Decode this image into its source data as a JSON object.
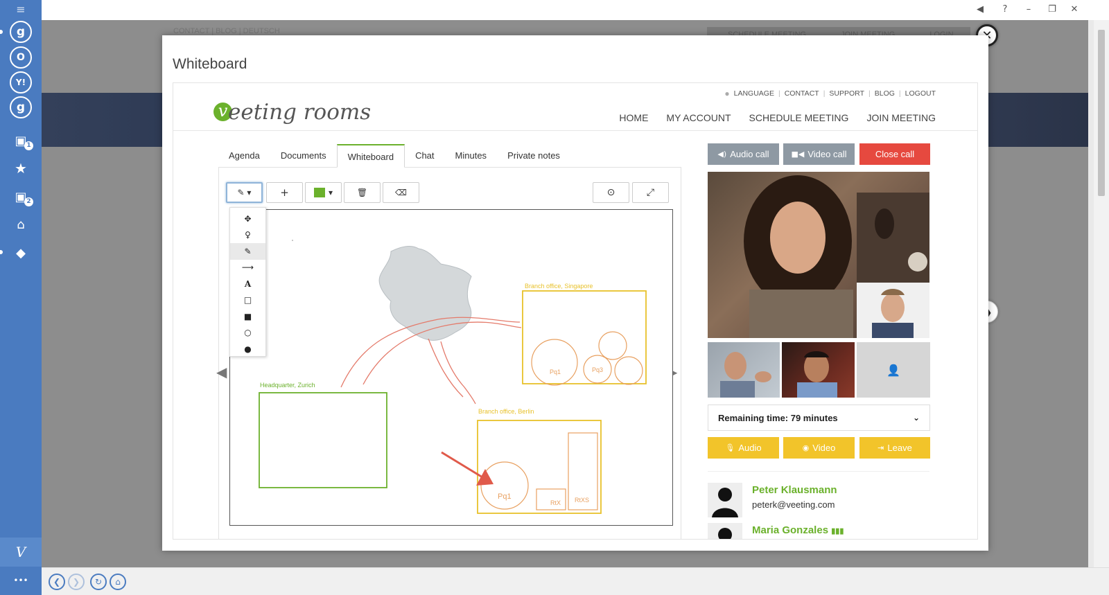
{
  "window": {
    "controls": [
      "◀",
      "?",
      "–",
      "❐",
      "✕"
    ]
  },
  "sidebar": {
    "items": [
      {
        "name": "menu",
        "glyph": "≡",
        "badge": ""
      },
      {
        "name": "google-account-1",
        "glyph": "g",
        "badge": ""
      },
      {
        "name": "outlook",
        "glyph": "O",
        "badge": ""
      },
      {
        "name": "yahoo",
        "glyph": "Y!",
        "badge": ""
      },
      {
        "name": "google-account-2",
        "glyph": "g",
        "badge": ""
      },
      {
        "name": "meetings-1",
        "glyph": "▣",
        "badge": "1"
      },
      {
        "name": "favorites",
        "glyph": "★",
        "badge": ""
      },
      {
        "name": "meetings-2",
        "glyph": "▣",
        "badge": "2"
      },
      {
        "name": "inbox",
        "glyph": "⌂",
        "badge": ""
      },
      {
        "name": "tags",
        "glyph": "◆",
        "badge": ""
      },
      {
        "name": "veeting",
        "glyph": "V",
        "badge": ""
      },
      {
        "name": "more",
        "glyph": "•••",
        "badge": ""
      }
    ]
  },
  "background_page": {
    "top_links": "CONTACT  |  BLOG  |  DEUTSCH",
    "right_links": [
      "SCHEDULE MEETING",
      "JOIN MEETING",
      "LOGIN"
    ]
  },
  "modal": {
    "title": "Whiteboard",
    "close_glyph": "✕",
    "next_glyph": "❯"
  },
  "site": {
    "logo_letter": "v",
    "logo_text": "eeting rooms",
    "top_links": [
      "LANGUAGE",
      "CONTACT",
      "SUPPORT",
      "BLOG",
      "LOGOUT"
    ],
    "main_nav": [
      "HOME",
      "MY ACCOUNT",
      "SCHEDULE MEETING",
      "JOIN MEETING"
    ]
  },
  "tabs": [
    "Agenda",
    "Documents",
    "Whiteboard",
    "Chat",
    "Minutes",
    "Private notes"
  ],
  "active_tab": "Whiteboard",
  "toolbar": {
    "pen_glyph": "✎ ▾",
    "add_glyph": "+",
    "color_caret": "▾",
    "delete_glyph": "🗑",
    "eraser_glyph": "⌫",
    "center_glyph": "⊙",
    "fullscreen_glyph": "⤢",
    "current_color": "#6bb12c"
  },
  "tool_menu": [
    {
      "name": "move",
      "glyph": "✥"
    },
    {
      "name": "highlight",
      "glyph": "♀"
    },
    {
      "name": "pen",
      "glyph": "✎"
    },
    {
      "name": "arrow",
      "glyph": "⟶"
    },
    {
      "name": "text",
      "glyph": "A"
    },
    {
      "name": "rectangle-outline",
      "glyph": "□"
    },
    {
      "name": "rectangle-filled",
      "glyph": "■"
    },
    {
      "name": "circle-outline",
      "glyph": "○"
    },
    {
      "name": "circle-filled",
      "glyph": "●"
    }
  ],
  "selected_tool": "pen",
  "whiteboard": {
    "labels": {
      "headquarter": "Headquarter, Zurich",
      "singapore": "Branch office, Singapore",
      "berlin": "Branch office, Berlin",
      "pq1_small": "Pq1",
      "pq3": "Pq3",
      "pq1_large": "Pq1",
      "rtx": "RtX",
      "rtxs": "RtXS"
    },
    "colors": {
      "green": "#6bb12c",
      "yellow": "#e8c12a",
      "orange": "#e8a060",
      "red": "#e05a4a",
      "map": "#cfd3d5"
    },
    "prev_glyph": "◀",
    "next_glyph": "▶"
  },
  "call": {
    "audio_call": "Audio call",
    "video_call": "Video call",
    "close_call": "Close call",
    "remaining_time": "Remaining time: 79 minutes",
    "audio": "Audio",
    "video": "Video",
    "leave": "Leave"
  },
  "participants": [
    {
      "name": "Peter Klausmann",
      "email": "peterk@veeting.com"
    },
    {
      "name": "Maria Gonzales",
      "email": ""
    }
  ],
  "colors": {
    "sidebar": "#4a7bc0",
    "accent_green": "#6bb12c",
    "call_gray": "#8e99a3",
    "close_call_red": "#e6493f",
    "action_yellow": "#f2c42a"
  }
}
